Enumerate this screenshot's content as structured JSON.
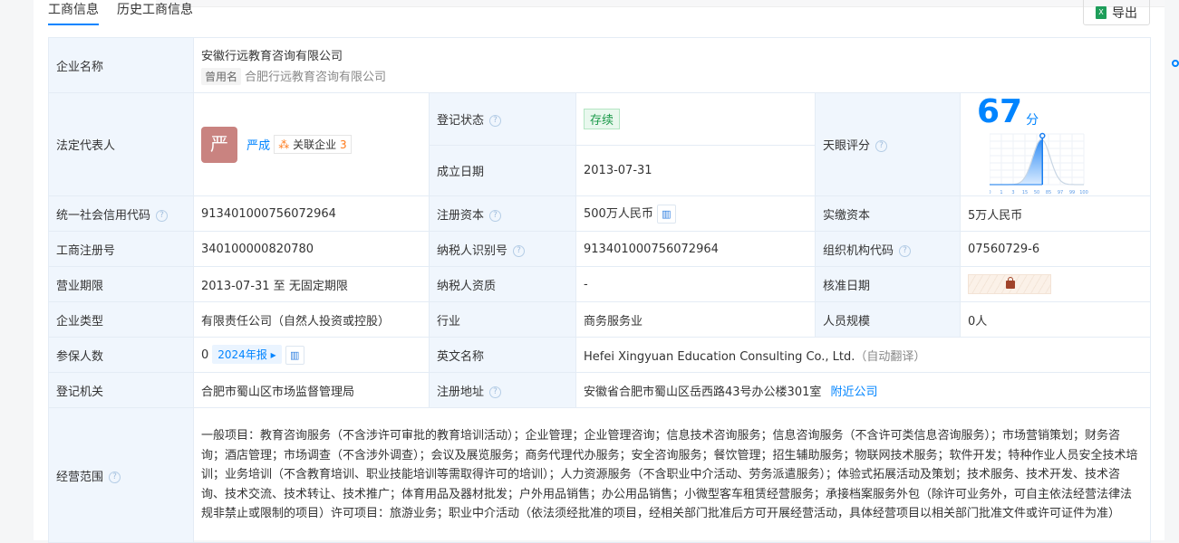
{
  "tabs": [
    "工商信息",
    "历史工商信息"
  ],
  "export_label": "导出",
  "company": {
    "label": "企业名称",
    "name": "安徽行远教育咨询有限公司",
    "former_tag": "曾用名",
    "former_name": "合肥行远教育咨询有限公司"
  },
  "legal": {
    "label": "法定代表人",
    "avatar": "严",
    "name": "严成",
    "related_label": "关联企业",
    "related_count": "3"
  },
  "reg_status": {
    "label": "登记状态",
    "value": "存续"
  },
  "found_date": {
    "label": "成立日期",
    "value": "2013-07-31"
  },
  "tianyan": {
    "label": "天眼评分",
    "score": "67",
    "unit": "分",
    "ticks": [
      "0",
      "1",
      "3",
      "15",
      "50",
      "85",
      "97",
      "99",
      "100"
    ],
    "marker_percentile": 0.56
  },
  "rows": [
    [
      {
        "l": "统一社会信用代码",
        "q": true,
        "v": "913401000756072964"
      },
      {
        "l": "注册资本",
        "q": true,
        "v": "500万人民币",
        "chart": true
      },
      {
        "l": "实缴资本",
        "v": "5万人民币"
      }
    ],
    [
      {
        "l": "工商注册号",
        "v": "340100000820780"
      },
      {
        "l": "纳税人识别号",
        "q": true,
        "v": "913401000756072964"
      },
      {
        "l": "组织机构代码",
        "q": true,
        "v": "07560729-6"
      }
    ],
    [
      {
        "l": "营业期限",
        "v": "2013-07-31 至 无固定期限"
      },
      {
        "l": "纳税人资质",
        "v": "-"
      },
      {
        "l": "核准日期",
        "locked": true
      }
    ],
    [
      {
        "l": "企业类型",
        "v": "有限责任公司（自然人投资或控股）"
      },
      {
        "l": "行业",
        "v": "商务服务业"
      },
      {
        "l": "人员规模",
        "v": "0人"
      }
    ]
  ],
  "insured": {
    "label": "参保人数",
    "value": "0",
    "report": "2024年报"
  },
  "english": {
    "label": "英文名称",
    "value": "Hefei Xingyuan Education Consulting Co., Ltd.",
    "note": "（自动翻译）"
  },
  "authority": {
    "label": "登记机关",
    "value": "合肥市蜀山区市场监督管理局"
  },
  "address": {
    "label": "注册地址",
    "value": "安徽省合肥市蜀山区岳西路43号办公楼301室",
    "link": "附近公司"
  },
  "scope": {
    "label": "经营范围",
    "value": "一般项目：教育咨询服务（不含涉许可审批的教育培训活动）；企业管理；企业管理咨询；信息技术咨询服务；信息咨询服务（不含许可类信息咨询服务）；市场营销策划；财务咨询；酒店管理；市场调查（不含涉外调查）；会议及展览服务；商务代理代办服务；安全咨询服务；餐饮管理；招生辅助服务；物联网技术服务；软件开发；特种作业人员安全技术培训；业务培训（不含教育培训、职业技能培训等需取得许可的培训）；人力资源服务（不含职业中介活动、劳务派遣服务）；体验式拓展活动及策划；技术服务、技术开发、技术咨询、技术交流、技术转让、技术推广；体育用品及器材批发；户外用品销售；办公用品销售；小微型客车租赁经营服务；承接档案服务外包（除许可业务外，可自主依法经营法律法规非禁止或限制的项目）许可项目：旅游业务；职业中介活动（依法须经批准的项目，经相关部门批准后方可开展经营活动，具体经营项目以相关部门批准文件或许可证件为准）"
  }
}
